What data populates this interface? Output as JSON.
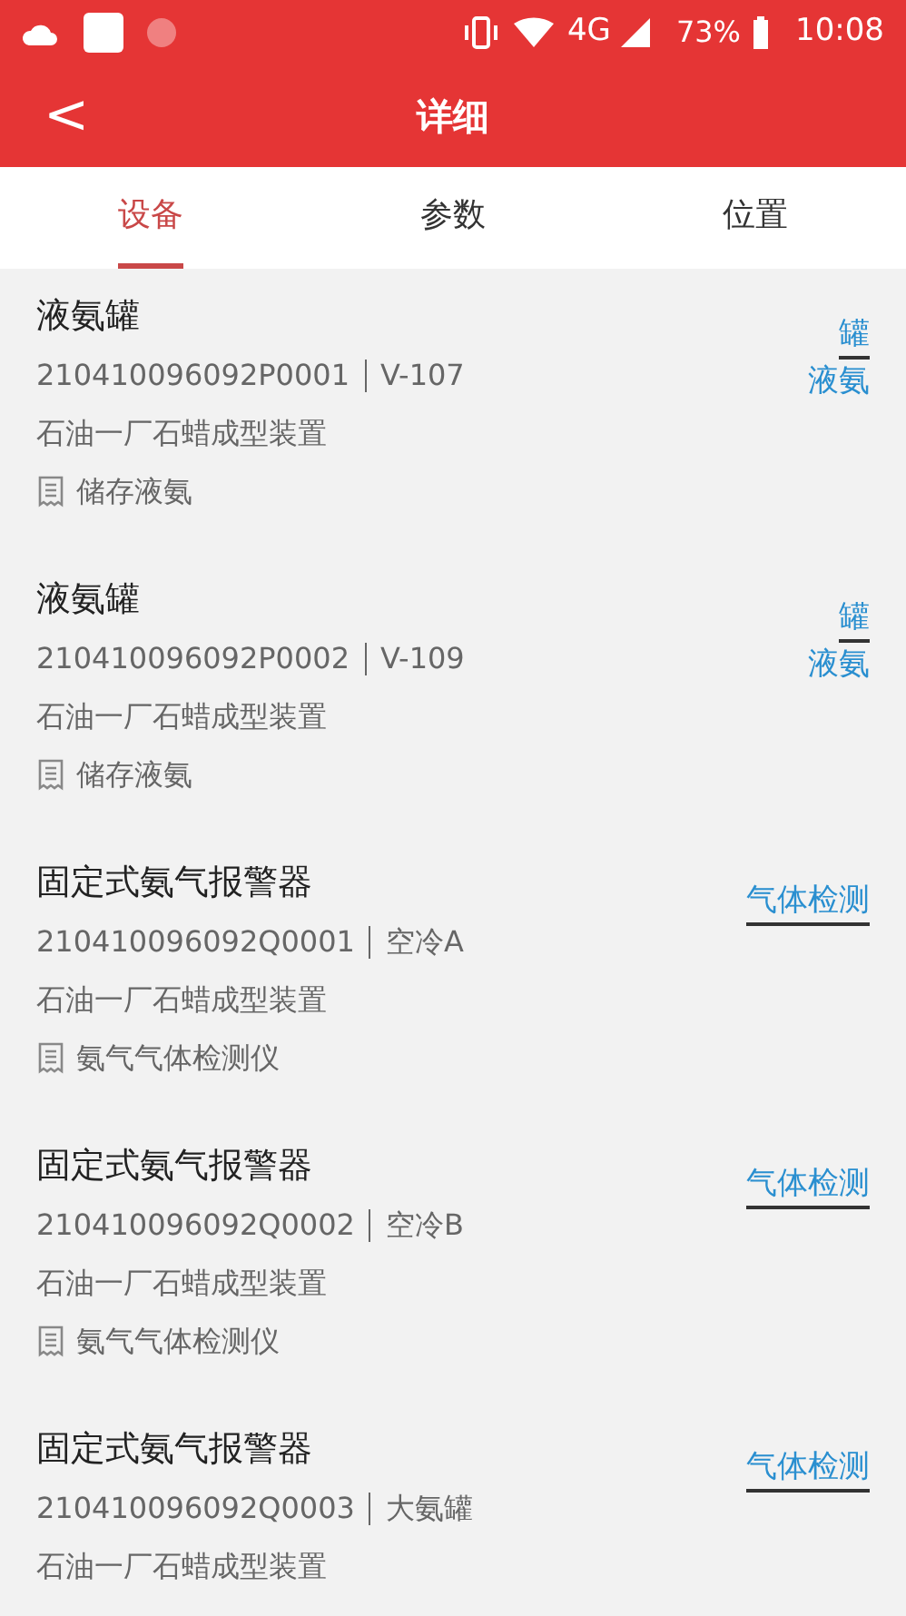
{
  "status_bar": {
    "network": "4G",
    "battery": "73%",
    "time": "10:08"
  },
  "header": {
    "back": "<",
    "title": "详细"
  },
  "tabs": [
    {
      "label": "设备",
      "selected": true
    },
    {
      "label": "参数",
      "selected": false
    },
    {
      "label": "位置",
      "selected": false
    }
  ],
  "items": [
    {
      "name": "液氨罐",
      "code": "210410096092P0001",
      "tag_no": "V-107",
      "location": "石油一厂石蜡成型装置",
      "description": "储存液氨",
      "tag_lines": [
        "罐",
        "液氨"
      ]
    },
    {
      "name": "液氨罐",
      "code": "210410096092P0002",
      "tag_no": "V-109",
      "location": "石油一厂石蜡成型装置",
      "description": "储存液氨",
      "tag_lines": [
        "罐",
        "液氨"
      ]
    },
    {
      "name": "固定式氨气报警器",
      "code": "210410096092Q0001",
      "tag_no": "空冷A",
      "location": "石油一厂石蜡成型装置",
      "description": "氨气气体检测仪",
      "tag_lines": [
        "气体检测"
      ]
    },
    {
      "name": "固定式氨气报警器",
      "code": "210410096092Q0002",
      "tag_no": "空冷B",
      "location": "石油一厂石蜡成型装置",
      "description": "氨气气体检测仪",
      "tag_lines": [
        "气体检测"
      ]
    },
    {
      "name": "固定式氨气报警器",
      "code": "210410096092Q0003",
      "tag_no": "大氨罐",
      "location": "石油一厂石蜡成型装置",
      "tag_lines": [
        "气体检测"
      ]
    }
  ]
}
